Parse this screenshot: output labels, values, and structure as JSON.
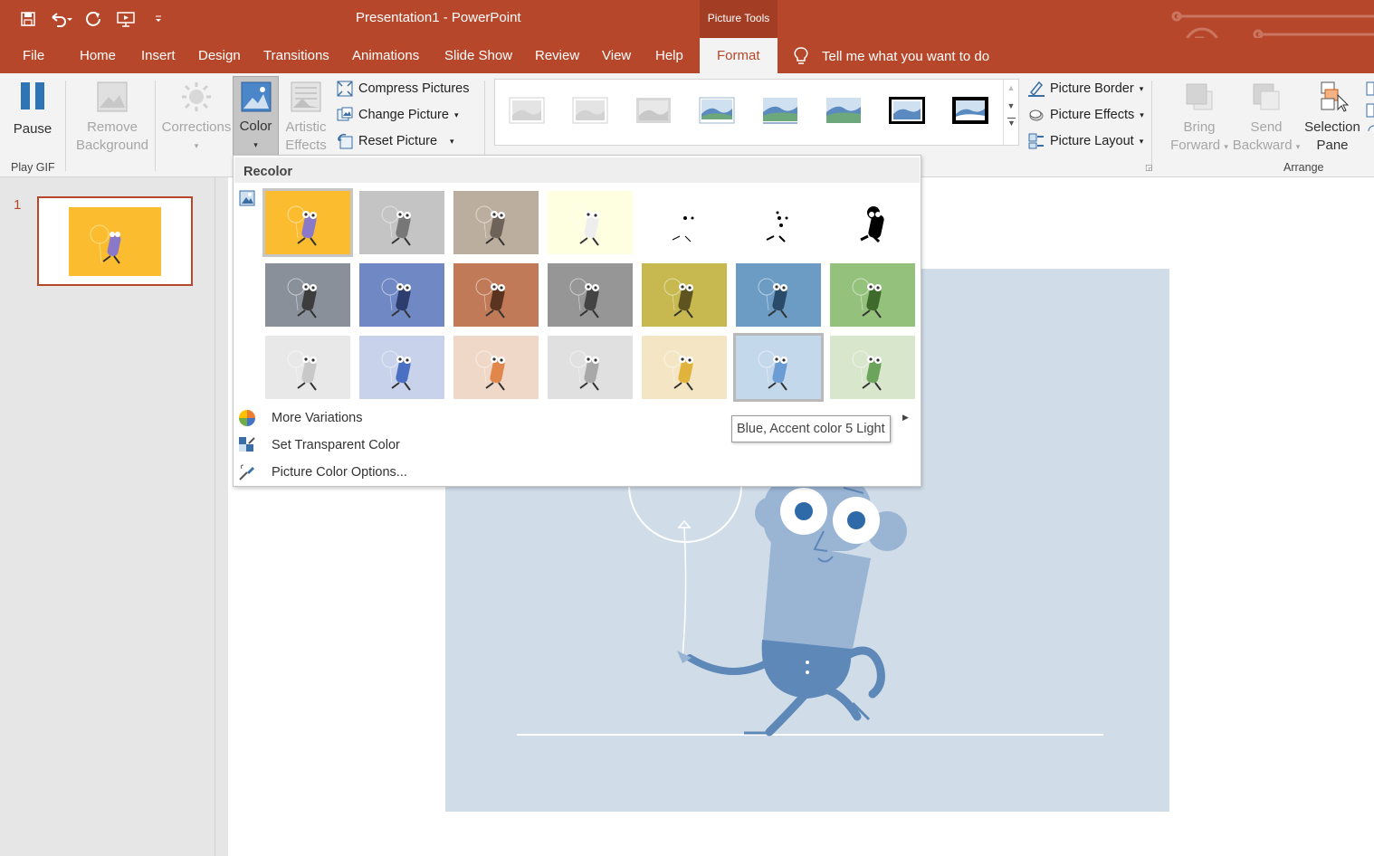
{
  "title_bar": {
    "document_title": "Presentation1  -  PowerPoint",
    "context_tab_group": "Picture Tools",
    "quick_access": [
      "save-icon",
      "undo-icon",
      "redo-icon",
      "present-icon",
      "customize-icon"
    ]
  },
  "tabs": [
    {
      "label": "File"
    },
    {
      "label": "Home"
    },
    {
      "label": "Insert"
    },
    {
      "label": "Design"
    },
    {
      "label": "Transitions"
    },
    {
      "label": "Animations"
    },
    {
      "label": "Slide Show"
    },
    {
      "label": "Review"
    },
    {
      "label": "View"
    },
    {
      "label": "Help"
    },
    {
      "label": "Format",
      "active": true
    }
  ],
  "tell_me": "Tell me what you want to do",
  "ribbon": {
    "pause": "Pause",
    "play_gif_group": "Play GIF",
    "remove_bg": [
      "Remove",
      "Background"
    ],
    "corrections": "Corrections",
    "color": "Color",
    "artistic_effects": [
      "Artistic",
      "Effects"
    ],
    "compress": "Compress Pictures",
    "change_picture": "Change Picture",
    "reset_picture": "Reset Picture",
    "picture_border": "Picture Border",
    "picture_effects": "Picture Effects",
    "picture_layout": "Picture Layout",
    "bring_forward": [
      "Bring",
      "Forward"
    ],
    "send_backward": [
      "Send",
      "Backward"
    ],
    "selection_pane": [
      "Selection",
      "Pane"
    ],
    "arrange_group": "Arrange"
  },
  "slides_pane": {
    "slide_number": "1"
  },
  "recolor_menu": {
    "header": "Recolor",
    "rows": [
      [
        {
          "name": "No Recolor",
          "bg": "#fbbd2f",
          "fig": "#8a78c8"
        },
        {
          "name": "Grayscale",
          "bg": "#c4c4c4",
          "fig": "#777777"
        },
        {
          "name": "Sepia",
          "bg": "#bcae9e",
          "fig": "#6d6358"
        },
        {
          "name": "Washout",
          "bg": "#fefee0",
          "fig": "#eeeeee"
        },
        {
          "name": "Black and White 25%",
          "bg": "#ffffff",
          "fig": "#000000"
        },
        {
          "name": "Black and White 50%",
          "bg": "#ffffff",
          "fig": "#000000"
        },
        {
          "name": "Black and White 75%",
          "bg": "#ffffff",
          "fig": "#000000"
        }
      ],
      [
        {
          "name": "Dark 1",
          "bg": "#8a909a",
          "fig": "#3d3d3d"
        },
        {
          "name": "Blue Dark",
          "bg": "#7088c4",
          "fig": "#2d3d6e"
        },
        {
          "name": "Orange Dark",
          "bg": "#c07a58",
          "fig": "#5a3420"
        },
        {
          "name": "Gray Dark",
          "bg": "#969696",
          "fig": "#444444"
        },
        {
          "name": "Gold Dark",
          "bg": "#c7b850",
          "fig": "#5e5420"
        },
        {
          "name": "Blue Dark 2",
          "bg": "#6c9cc4",
          "fig": "#2b4b6a"
        },
        {
          "name": "Green Dark",
          "bg": "#94c27c",
          "fig": "#3e6a2c"
        }
      ],
      [
        {
          "name": "Light 1",
          "bg": "#e8e8e8",
          "fig": "#c8c8c8"
        },
        {
          "name": "Blue Light",
          "bg": "#c8d2ea",
          "fig": "#4a70c4"
        },
        {
          "name": "Orange Light",
          "bg": "#f0d8c8",
          "fig": "#e0884c"
        },
        {
          "name": "Gray Light",
          "bg": "#e0e0e0",
          "fig": "#a8a8a8"
        },
        {
          "name": "Gold Light",
          "bg": "#f4e6c4",
          "fig": "#e0b43c"
        },
        {
          "name": "Blue, Accent color 5 Light",
          "bg": "#c4d8ec",
          "fig": "#6c9cd4"
        },
        {
          "name": "Green Light",
          "bg": "#d8e6cc",
          "fig": "#6ca45c"
        }
      ]
    ],
    "more_variations": "More Variations",
    "set_transparent": "Set Transparent Color",
    "picture_color_options": "Picture Color Options...",
    "tooltip": "Blue, Accent color 5 Light"
  },
  "colors": {
    "accent": "#b7472a",
    "slide_bg": "#d0dde9",
    "figure": "#9ab4d4"
  }
}
